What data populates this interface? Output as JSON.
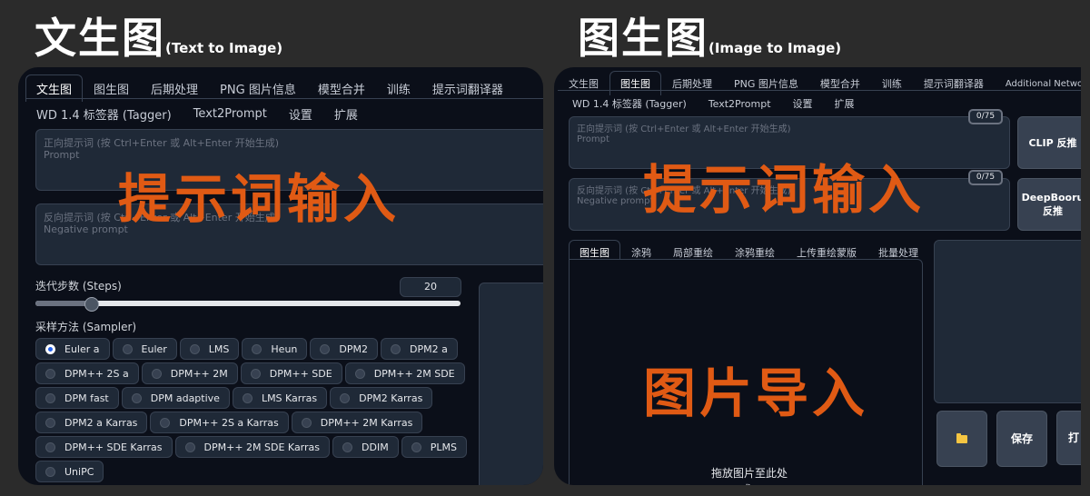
{
  "header_left": {
    "big": "文生图",
    "small": "(Text to Image)"
  },
  "header_right": {
    "big": "图生图",
    "small": "(Image to Image)"
  },
  "left": {
    "tabs_row1": [
      "文生图",
      "图生图",
      "后期处理",
      "PNG 图片信息",
      "模型合并",
      "训练",
      "提示词翻译器"
    ],
    "tabs_row2": [
      "WD 1.4 标签器 (Tagger)",
      "Text2Prompt",
      "设置",
      "扩展"
    ],
    "prompt_placeholder": "正向提示词 (按 Ctrl+Enter 或 Alt+Enter 开始生成)",
    "prompt_sub": "Prompt",
    "neg_placeholder": "反向提示词 (按 Ctrl+Enter 或 Alt+Enter 开始生成)",
    "neg_sub": "Negative prompt",
    "overlay": "提示词输入",
    "steps_label": "迭代步数 (Steps)",
    "steps_value": "20",
    "steps_fraction": 0.13,
    "sampler_label": "采样方法 (Sampler)",
    "samplers": [
      [
        "Euler a",
        "Euler",
        "LMS",
        "Heun",
        "DPM2",
        "DPM2 a"
      ],
      [
        "DPM++ 2S a",
        "DPM++ 2M",
        "DPM++ SDE",
        "DPM++ 2M SDE"
      ],
      [
        "DPM fast",
        "DPM adaptive",
        "LMS Karras",
        "DPM2 Karras"
      ],
      [
        "DPM2 a Karras",
        "DPM++ 2S a Karras",
        "DPM++ 2M Karras"
      ],
      [
        "DPM++ SDE Karras",
        "DPM++ 2M SDE Karras",
        "DDIM",
        "PLMS"
      ],
      [
        "UniPC"
      ]
    ],
    "selected_sampler": "Euler a"
  },
  "right": {
    "tabs_row1": [
      "文生图",
      "图生图",
      "后期处理",
      "PNG 图片信息",
      "模型合并",
      "训练",
      "提示词翻译器",
      "Additional Networks"
    ],
    "tabs_row2": [
      "WD 1.4 标签器 (Tagger)",
      "Text2Prompt",
      "设置",
      "扩展"
    ],
    "prompt_placeholder": "正向提示词 (按 Ctrl+Enter 或 Alt+Enter 开始生成)",
    "prompt_sub": "Prompt",
    "neg_placeholder": "反向提示词 (按 Ctrl+Enter 或 Alt+Enter 开始生成)",
    "neg_sub": "Negative prompt",
    "counter1": "0/75",
    "counter2": "0/75",
    "clip_button": "CLIP 反推",
    "deepbooru_line1": "DeepBooru",
    "deepbooru_line2": "反推",
    "overlay_prompt": "提示词输入",
    "img_tabs": [
      "图生图",
      "涂鸦",
      "局部重绘",
      "涂鸦重绘",
      "上传重绘蒙版",
      "批量处理"
    ],
    "overlay_image": "图片导入",
    "drop_text": "拖放图片至此处",
    "drop_or": "或",
    "folder_icon": "folder-icon",
    "save_button": "保存",
    "cut_button": "打"
  }
}
